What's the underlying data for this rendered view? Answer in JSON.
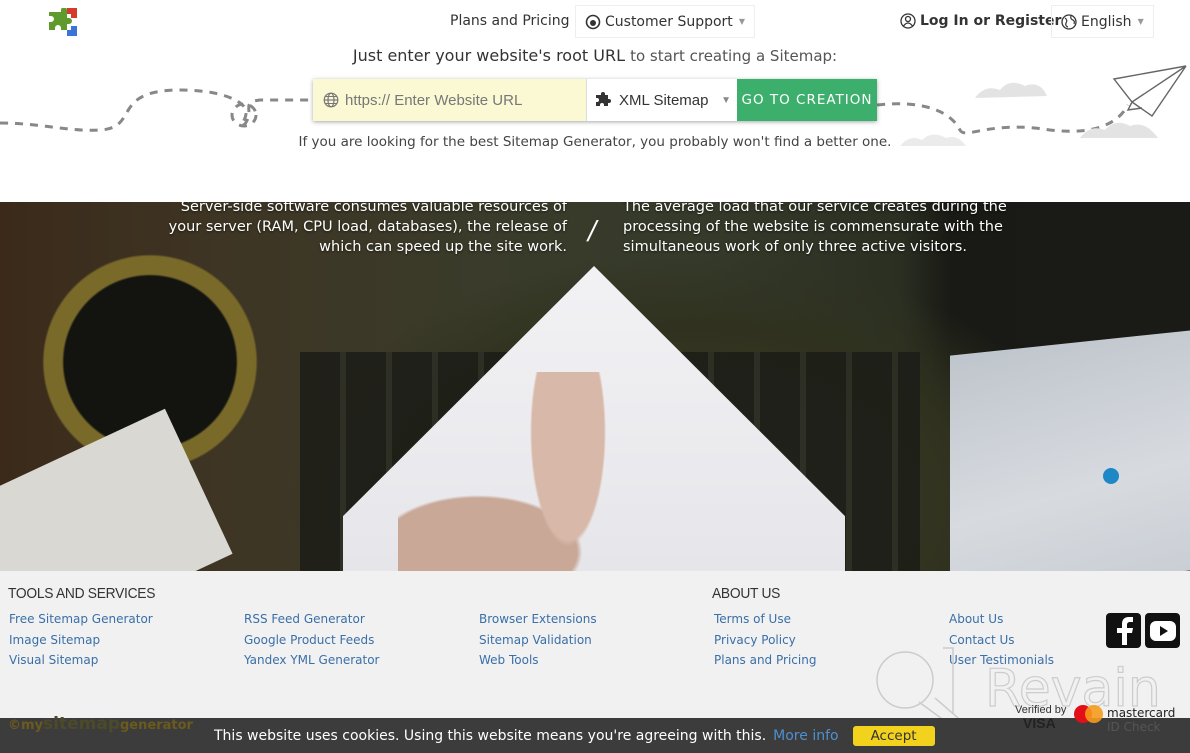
{
  "header": {
    "logo": "puzzle-logo",
    "nav": {
      "plans": "Plans and Pricing",
      "support": "Customer Support",
      "login": "Log In or Register",
      "language": "English"
    },
    "tagline_strong": "Just enter your website's root URL",
    "tagline_light": "to start creating a Sitemap:",
    "url_placeholder": "https:// Enter Website URL",
    "url_value": "",
    "sitemap_type": "XML Sitemap",
    "go_button": "GO TO CREATION",
    "subline": "If you are looking for the best Sitemap Generator, you probably won't find a better one."
  },
  "hero": {
    "left_text": "Server-side software consumes valuable resources of your server (RAM, CPU load, databases), the release of which can speed up the site work.",
    "separator": "/",
    "right_text": "The average load that our service creates during the processing of the website is commensurate with the simultaneous work of only three active visitors."
  },
  "footer": {
    "tools_heading": "TOOLS AND SERVICES",
    "about_heading": "ABOUT US",
    "tools_col1": [
      "Free Sitemap Generator",
      "Image Sitemap",
      "Visual Sitemap"
    ],
    "tools_col2": [
      "RSS Feed Generator",
      "Google Product Feeds",
      "Yandex YML Generator"
    ],
    "tools_col3": [
      "Browser Extensions",
      "Sitemap Validation",
      "Web Tools"
    ],
    "about_col1": [
      "Terms of Use",
      "Privacy Policy",
      "Plans and Pricing"
    ],
    "about_col2": [
      "About Us",
      "Contact Us",
      "User Testimonials"
    ],
    "social": [
      "facebook-icon",
      "youtube-icon"
    ],
    "brand": {
      "prefix": "©my",
      "main": "sitemap",
      "suffix": "generator"
    },
    "payments": {
      "verified_by": "Verified by",
      "visa": "VISA",
      "mastercard": "mastercard",
      "id_check": "ID Check"
    },
    "watermark": "Revain"
  },
  "cookie": {
    "message": "This website uses cookies. Using this website means you're agreeing with this.",
    "more_info": "More info",
    "accept": "Accept"
  },
  "colors": {
    "go_button": "#3daf6c",
    "url_field_bg": "#fbf9d3",
    "link": "#3a6fa8",
    "cookie_bg": "#3c3c3c",
    "accept_bg": "#f2d21d"
  }
}
